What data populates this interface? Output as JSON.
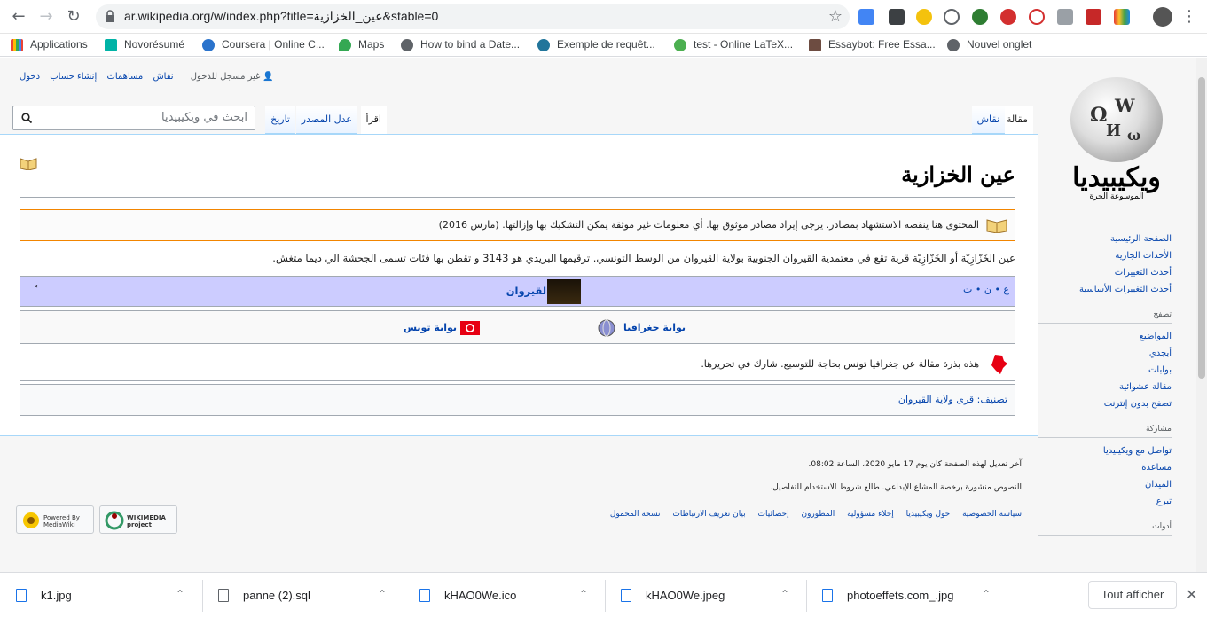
{
  "browser": {
    "url": "ar.wikipedia.org/w/index.php?title=عين_الخزازية&stable=0",
    "bookmarks": [
      "Applications",
      "Novorésumé",
      "Coursera | Online C...",
      "Maps",
      "How to bind a Date...",
      "Exemple de requêt...",
      "test - Online LaTeX...",
      "Essaybot: Free Essa...",
      "Nouvel onglet"
    ]
  },
  "personal": {
    "anon": "غير مسجل للدخول",
    "talk": "نقاش",
    "contribs": "مساهمات",
    "create": "إنشاء حساب",
    "login": "دخول"
  },
  "logo": {
    "wordmark": "ويكيبيديا",
    "tagline": "الموسوعة الحرة"
  },
  "tabs": {
    "article": "مقالة",
    "talk": "نقاش",
    "read": "اقرأ",
    "edit": "عدل المصدر",
    "history": "تاريخ"
  },
  "search": {
    "placeholder": "ابحث في ويكيبيديا"
  },
  "sidebar": {
    "nav": [
      "الصفحة الرئيسية",
      "الأحداث الجارية",
      "أحدث التغييرات",
      "أحدث التغييرات الأساسية"
    ],
    "browse_heading": "تصفح",
    "browse": [
      "المواضيع",
      "أبجدي",
      "بوابات",
      "مقالة عشوائية",
      "تصفح بدون إنترنت"
    ],
    "participate_heading": "مشاركة",
    "participate": [
      "تواصل مع ويكيبيديا",
      "مساعدة",
      "الميدان",
      "تبرع"
    ],
    "tools_heading": "أدوات"
  },
  "article": {
    "title": "عين الخزازية",
    "notice": "المحتوى هنا ينقصه الاستشهاد بمصادر. يرجى إيراد مصادر موثوق بها. أي معلومات غير موثقة يمكن التشكيك بها وإزالتها. (مارس 2016)",
    "lead": "عين الخَزّازِيّة أو الخَزّازِيّة قرية تقع في معتمدية القيروان الجنوبية بولاية القيروان من الوسط التونسي. ترقيمها البريدي هو 3143 و تقطن بها فئات تسمى الجحشة الي ديما متغش.",
    "navbox_title": "ولاية القيروان",
    "navbox_vte": "ع • ن • ت",
    "navbox_toggle": "˂",
    "portal_geo": "بوابة جغرافيا",
    "portal_tunisia": "بوابة تونس",
    "stub": "هذه بذرة مقالة عن جغرافيا تونس بحاجة للتوسيع. شارك في تحريرها.",
    "categories": "تصنيف:  قرى ولاية القيروان"
  },
  "footer": {
    "last_mod": "آخر تعديل لهذه الصفحة كان يوم 17 مايو 2020، الساعة 08:02.",
    "license": "النصوص منشورة برخصة المشاع الإبداعي. طالع شروط الاستخدام للتفاصيل.",
    "links": [
      "سياسة الخصوصية",
      "حول ويكيبيديا",
      "إخلاء مسؤولية",
      "المطورون",
      "إحصائيات",
      "بيان تعريف الارتباطات",
      "نسخة المحمول"
    ],
    "badge_wikimedia": "WIKIMEDIA project",
    "badge_mediawiki": "Powered By MediaWiki"
  },
  "downloads": {
    "files": [
      "k1.jpg",
      "panne (2).sql",
      "kHAO0We.ico",
      "kHAO0We.jpeg",
      "photoeffets.com_.jpg"
    ],
    "show_all": "Tout afficher"
  }
}
